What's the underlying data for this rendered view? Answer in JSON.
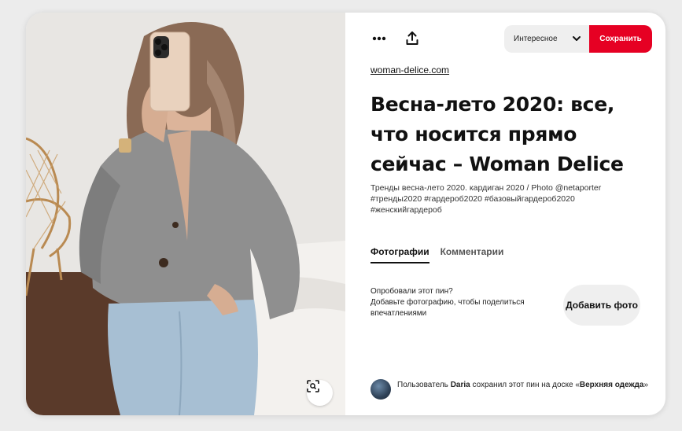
{
  "pin": {
    "image_alt": "Woman in grey cardigan and light-blue jeans taking a mirror selfie",
    "visual_search_icon": "lens-scan-icon"
  },
  "toolbar": {
    "more_icon": "more-dots-icon",
    "share_icon": "share-upload-icon",
    "board_selected": "Интересное",
    "save_label": "Сохранить",
    "save_color": "#e60023"
  },
  "source": {
    "domain": "woman-delice.com"
  },
  "title": "Весна-лето 2020: все, что носится прямо сейчас – Woman Delice",
  "description": "Тренды весна-лето 2020. кардиган 2020 / Photo @netaporter #тренды2020 #гардероб2020 #базовыйгардероб2020 #женскийгардероб",
  "tabs": [
    {
      "label": "Фотографии",
      "active": true
    },
    {
      "label": "Комментарии",
      "active": false
    }
  ],
  "tried": {
    "question": "Опробовали этот пин?",
    "prompt": "Добавьте фотографию, чтобы поделиться впечатлениями",
    "add_photo_label": "Добавить фото"
  },
  "saved_by": {
    "prefix": "Пользователь",
    "user": "Daria",
    "middle": "сохранил этот пин на доске «",
    "board": "Верхняя одежда",
    "suffix": "»"
  }
}
